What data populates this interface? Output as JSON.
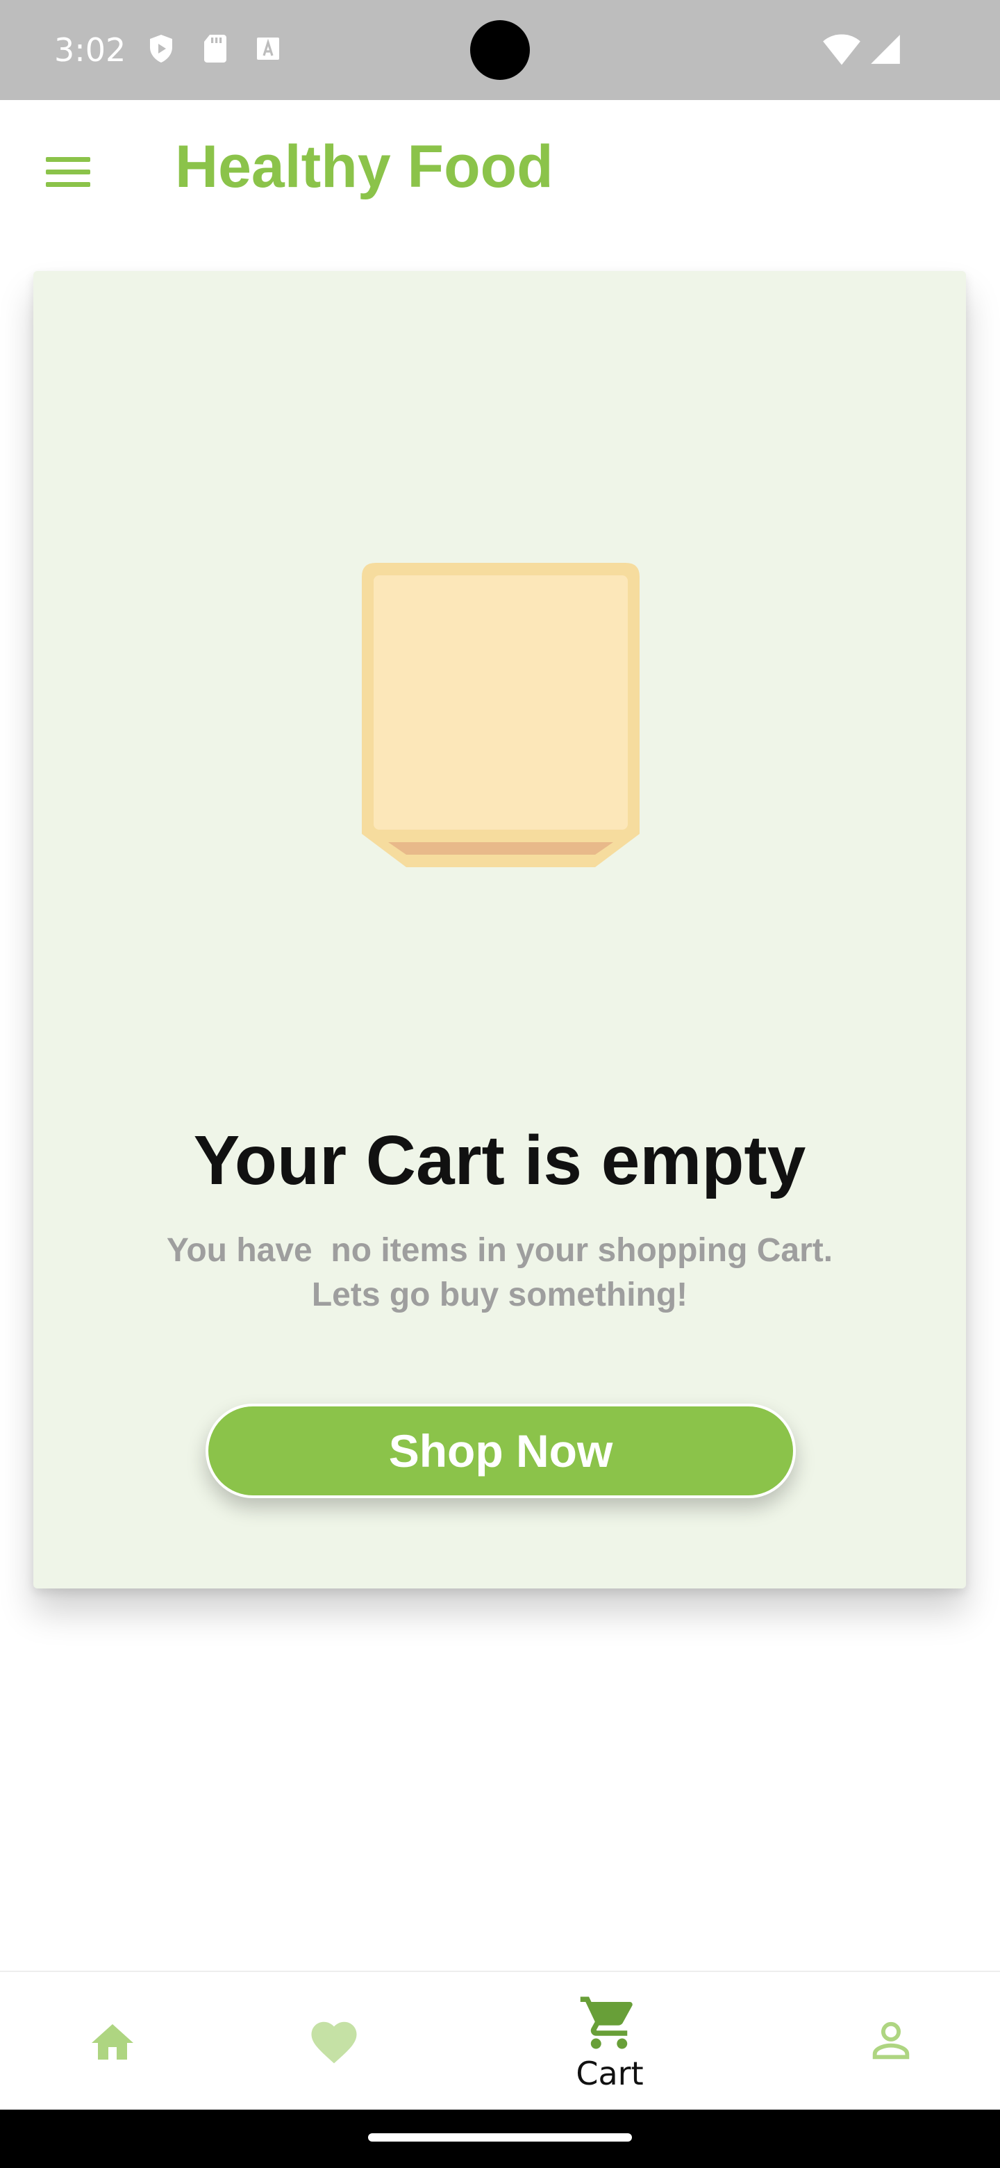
{
  "status_bar": {
    "time": "3:02",
    "icons": [
      "shield-play-icon",
      "sd-card-icon",
      "font-a-icon",
      "wifi-icon",
      "cell-signal-icon"
    ]
  },
  "app_bar": {
    "title": "Healthy Food",
    "menu_icon": "hamburger-menu-icon"
  },
  "empty_cart": {
    "illustration": "empty-box-icon",
    "title": "Your Cart is empty",
    "subtitle_line1": "You have  no items in your shopping Cart.",
    "subtitle_line2": "Lets go buy something!",
    "button_label": "Shop Now"
  },
  "bottom_nav": {
    "items": [
      {
        "icon": "home-icon",
        "label": ""
      },
      {
        "icon": "heart-icon",
        "label": ""
      },
      {
        "icon": "cart-icon",
        "label": "Cart",
        "active": true
      },
      {
        "icon": "person-icon",
        "label": ""
      }
    ]
  },
  "colors": {
    "accent": "#8bc34a",
    "accent_light": "#c5e1a5",
    "card_bg": "#eff5e8",
    "status_bar": "#bdbdbd",
    "subtitle_gray": "#9e9e9e"
  }
}
